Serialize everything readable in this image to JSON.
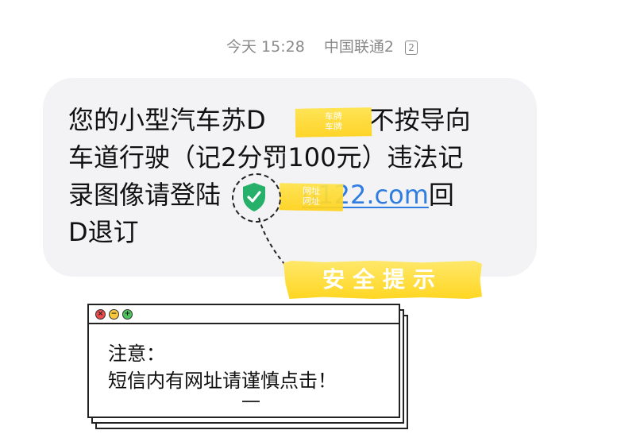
{
  "header": {
    "day": "今天",
    "time": "15:28",
    "carrier": "中国联通2",
    "sim_badge": "2"
  },
  "message": {
    "line1_a": "您的小型汽车苏D",
    "line1_b": "不按导向",
    "line2": "车道行驶（记2分罚100元）违法记",
    "line3_a": "录图像请登陆",
    "line3_link": "u122.com",
    "line3_b": "回",
    "line4": "D退订"
  },
  "redactions": {
    "plate_label_1": "车牌",
    "plate_label_2": "车牌",
    "url_label_1": "网址",
    "url_label_2": "网址"
  },
  "safety_tip": {
    "label": "安全提示"
  },
  "warning_window": {
    "title_line": "注意：",
    "body_line": "短信内有网址请谨慎点击！",
    "close_glyph": "×",
    "minimize_glyph": "−",
    "maximize_glyph": "+"
  },
  "colors": {
    "link": "#2f7de1",
    "shield": "#27b06a",
    "highlighter": "#ffd21a",
    "bubble": "#f3f3f5"
  },
  "icons": [
    "sim-card-icon",
    "shield-check-icon",
    "close-dot-icon",
    "minimize-dot-icon",
    "maximize-dot-icon"
  ]
}
